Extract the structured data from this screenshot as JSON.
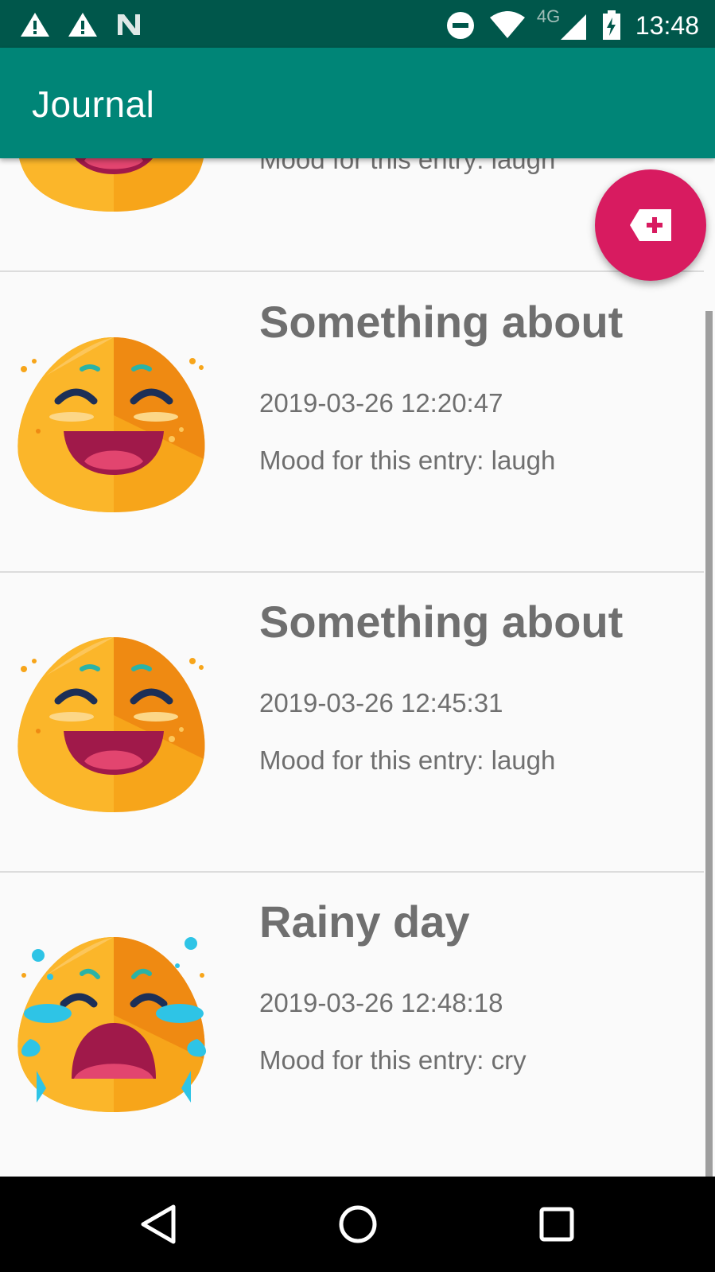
{
  "status_bar": {
    "time": "13:48",
    "network": "4G",
    "icons": [
      "warning-icon",
      "warning-icon",
      "n-notification-icon",
      "do-not-disturb-icon",
      "wifi-icon",
      "cell-signal-icon",
      "battery-charging-icon"
    ]
  },
  "app_bar": {
    "title": "Journal"
  },
  "fab": {
    "icon": "add-entry-icon",
    "color": "#d81b60"
  },
  "entries": [
    {
      "title": "",
      "date": "",
      "mood_text": "Mood for this entry: laugh",
      "mood": "laugh"
    },
    {
      "title": "Something about",
      "date": "2019-03-26 12:20:47",
      "mood_text": "Mood for this entry: laugh",
      "mood": "laugh"
    },
    {
      "title": "Something about",
      "date": "2019-03-26 12:45:31",
      "mood_text": "Mood for this entry: laugh",
      "mood": "laugh"
    },
    {
      "title": "Rainy day",
      "date": "2019-03-26 12:48:18",
      "mood_text": "Mood for this entry: cry",
      "mood": "cry"
    }
  ],
  "nav_bar": {
    "buttons": [
      "back-icon",
      "home-icon",
      "recents-icon"
    ]
  },
  "colors": {
    "primary_dark": "#00574b",
    "primary": "#008577",
    "accent": "#d81b60",
    "text": "#6f6f6f"
  }
}
